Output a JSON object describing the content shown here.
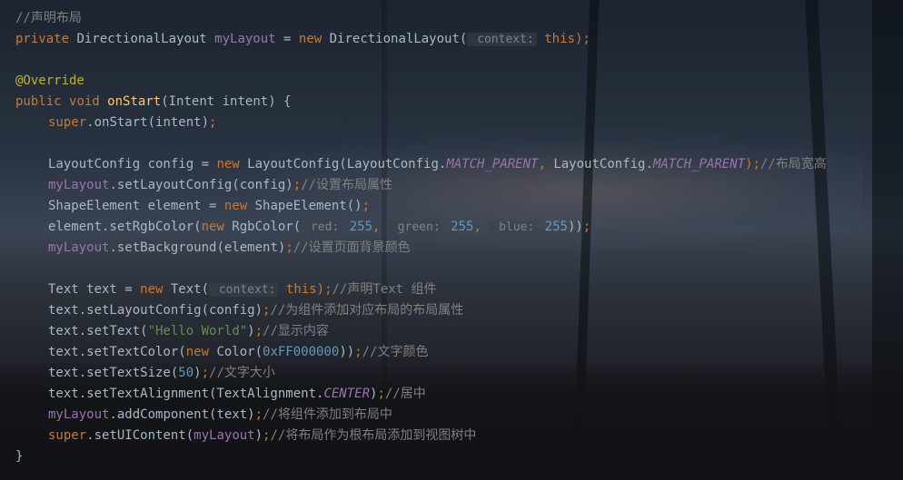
{
  "editor": {
    "lines": [
      {
        "indent": 0,
        "tokens": [
          {
            "text": "//声明布局",
            "type": "cm"
          }
        ]
      },
      {
        "indent": 0,
        "tokens": [
          {
            "text": "private ",
            "type": "kw"
          },
          {
            "text": "DirectionalLayout ",
            "type": "plain"
          },
          {
            "text": "myLayout",
            "type": "fld"
          },
          {
            "text": " = ",
            "type": "plain"
          },
          {
            "text": "new ",
            "type": "kw"
          },
          {
            "text": "DirectionalLayout(",
            "type": "plain"
          },
          {
            "text": " context:",
            "type": "hint"
          },
          {
            "text": " this",
            "type": "kw"
          },
          {
            "text": ");",
            "type": "kw"
          }
        ]
      },
      {
        "indent": 0,
        "tokens": []
      },
      {
        "indent": 0,
        "tokens": [
          {
            "text": "@Override",
            "type": "an"
          }
        ]
      },
      {
        "indent": 0,
        "tokens": [
          {
            "text": "public ",
            "type": "kw"
          },
          {
            "text": "void ",
            "type": "kw"
          },
          {
            "text": "onStart",
            "type": "fn"
          },
          {
            "text": "(Intent intent) {",
            "type": "plain"
          }
        ]
      },
      {
        "indent": 1,
        "tokens": [
          {
            "text": "super",
            "type": "kw"
          },
          {
            "text": ".onStart(intent)",
            "type": "plain"
          },
          {
            "text": ";",
            "type": "kw"
          }
        ]
      },
      {
        "indent": 0,
        "tokens": []
      },
      {
        "indent": 1,
        "tokens": [
          {
            "text": "LayoutConfig config = ",
            "type": "plain"
          },
          {
            "text": "new ",
            "type": "kw"
          },
          {
            "text": "LayoutConfig(LayoutConfig.",
            "type": "plain"
          },
          {
            "text": "MATCH_PARENT",
            "type": "st"
          },
          {
            "text": ", ",
            "type": "kw"
          },
          {
            "text": "LayoutConfig.",
            "type": "plain"
          },
          {
            "text": "MATCH_PARENT",
            "type": "st"
          },
          {
            "text": ");",
            "type": "kw"
          },
          {
            "text": "//布局宽高",
            "type": "cm"
          }
        ]
      },
      {
        "indent": 1,
        "tokens": [
          {
            "text": "myLayout",
            "type": "fld"
          },
          {
            "text": ".setLayoutConfig(config)",
            "type": "plain"
          },
          {
            "text": ";",
            "type": "kw"
          },
          {
            "text": "//设置布局属性",
            "type": "cm"
          }
        ]
      },
      {
        "indent": 1,
        "tokens": [
          {
            "text": "ShapeElement element = ",
            "type": "plain"
          },
          {
            "text": "new ",
            "type": "kw"
          },
          {
            "text": "ShapeElement()",
            "type": "plain"
          },
          {
            "text": ";",
            "type": "kw"
          }
        ]
      },
      {
        "indent": 1,
        "tokens": [
          {
            "text": "element.setRgbColor(",
            "type": "plain"
          },
          {
            "text": "new ",
            "type": "kw"
          },
          {
            "text": "RgbColor(",
            "type": "plain"
          },
          {
            "text": " red:",
            "type": "hint"
          },
          {
            "text": " 255",
            "type": "num"
          },
          {
            "text": ", ",
            "type": "kw"
          },
          {
            "text": " green:",
            "type": "hint"
          },
          {
            "text": " 255",
            "type": "num"
          },
          {
            "text": ", ",
            "type": "kw"
          },
          {
            "text": " blue:",
            "type": "hint"
          },
          {
            "text": " 255",
            "type": "num"
          },
          {
            "text": "))",
            "type": "plain"
          },
          {
            "text": ";",
            "type": "kw"
          }
        ]
      },
      {
        "indent": 1,
        "tokens": [
          {
            "text": "myLayout",
            "type": "fld"
          },
          {
            "text": ".setBackground(element)",
            "type": "plain"
          },
          {
            "text": ";",
            "type": "kw"
          },
          {
            "text": "//设置页面背景颜色",
            "type": "cm"
          }
        ]
      },
      {
        "indent": 0,
        "tokens": []
      },
      {
        "indent": 1,
        "tokens": [
          {
            "text": "Text text = ",
            "type": "plain"
          },
          {
            "text": "new ",
            "type": "kw"
          },
          {
            "text": "Text(",
            "type": "plain"
          },
          {
            "text": " context:",
            "type": "hint"
          },
          {
            "text": " this",
            "type": "kw"
          },
          {
            "text": ");",
            "type": "kw"
          },
          {
            "text": "//声明Text 组件",
            "type": "cm"
          }
        ]
      },
      {
        "indent": 1,
        "tokens": [
          {
            "text": "text.setLayoutConfig(config)",
            "type": "plain"
          },
          {
            "text": ";",
            "type": "kw"
          },
          {
            "text": "//为组件添加对应布局的布局属性",
            "type": "cm"
          }
        ]
      },
      {
        "indent": 1,
        "tokens": [
          {
            "text": "text.setText(",
            "type": "plain"
          },
          {
            "text": "\"Hello World\"",
            "type": "str"
          },
          {
            "text": ")",
            "type": "plain"
          },
          {
            "text": ";",
            "type": "kw"
          },
          {
            "text": "//显示内容",
            "type": "cm"
          }
        ]
      },
      {
        "indent": 1,
        "tokens": [
          {
            "text": "text.setTextColor(",
            "type": "plain"
          },
          {
            "text": "new ",
            "type": "kw"
          },
          {
            "text": "Color(",
            "type": "plain"
          },
          {
            "text": "0xFF000000",
            "type": "num"
          },
          {
            "text": "))",
            "type": "plain"
          },
          {
            "text": ";",
            "type": "kw"
          },
          {
            "text": "//文字颜色",
            "type": "cm"
          }
        ]
      },
      {
        "indent": 1,
        "tokens": [
          {
            "text": "text.setTextSize(",
            "type": "plain"
          },
          {
            "text": "50",
            "type": "num"
          },
          {
            "text": ")",
            "type": "plain"
          },
          {
            "text": ";",
            "type": "kw"
          },
          {
            "text": "//文字大小",
            "type": "cm"
          }
        ]
      },
      {
        "indent": 1,
        "tokens": [
          {
            "text": "text.setTextAlignment(TextAlignment.",
            "type": "plain"
          },
          {
            "text": "CENTER",
            "type": "st"
          },
          {
            "text": ")",
            "type": "plain"
          },
          {
            "text": ";",
            "type": "kw"
          },
          {
            "text": "//居中",
            "type": "cm"
          }
        ]
      },
      {
        "indent": 1,
        "tokens": [
          {
            "text": "myLayout",
            "type": "fld"
          },
          {
            "text": ".addComponent(text)",
            "type": "plain"
          },
          {
            "text": ";",
            "type": "kw"
          },
          {
            "text": "//将组件添加到布局中",
            "type": "cm"
          }
        ]
      },
      {
        "indent": 1,
        "tokens": [
          {
            "text": "super",
            "type": "kw"
          },
          {
            "text": ".setUIContent(",
            "type": "plain"
          },
          {
            "text": "myLayout",
            "type": "fld"
          },
          {
            "text": ")",
            "type": "plain"
          },
          {
            "text": ";",
            "type": "kw"
          },
          {
            "text": "//将布局作为根布局添加到视图树中",
            "type": "cm"
          }
        ]
      },
      {
        "indent": 0,
        "tokens": [
          {
            "text": "}",
            "type": "plain"
          }
        ]
      }
    ]
  },
  "colors": {
    "keyword": "#cc7832",
    "comment": "#808080",
    "method_decl": "#ffc66d",
    "annotation": "#bbb529",
    "field": "#9876aa",
    "number": "#6897bb",
    "string": "#6a8759",
    "text": "#a9b7c6"
  }
}
